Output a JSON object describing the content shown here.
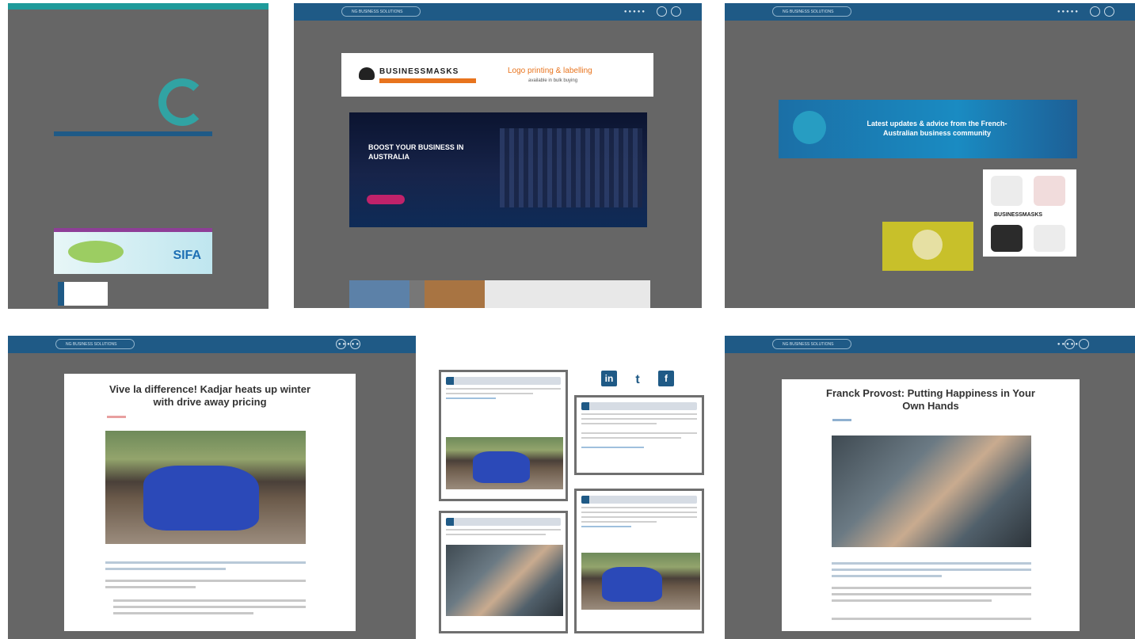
{
  "screens": {
    "header": {
      "pill_text": "NG BUSINESS SOLUTIONS",
      "dots": "●●●●●"
    },
    "panel2": {
      "masks_brand": "BUSINESSMASKS",
      "masks_tagline": "Logo printing & labelling",
      "masks_sub": "available in bulk buying",
      "boost_text": "BOOST YOUR BUSINESS IN AUSTRALIA"
    },
    "panel3": {
      "banner_text": "Latest updates & advice from the French-Australian business community",
      "mini_brand": "BUSINESSMASKS"
    },
    "panel1": {
      "sifa": "SIFA"
    },
    "article1": {
      "title": "Vive la difference! Kadjar heats up winter with drive away pricing"
    },
    "article2": {
      "title": "Franck Provost: Putting Happiness in Your Own Hands"
    },
    "social": {
      "linkedin": "in",
      "twitter": "t",
      "facebook": "f"
    }
  },
  "colors": {
    "nav": "#1f5a86",
    "panel_bg": "#666666",
    "accent_orange": "#e8741e"
  }
}
